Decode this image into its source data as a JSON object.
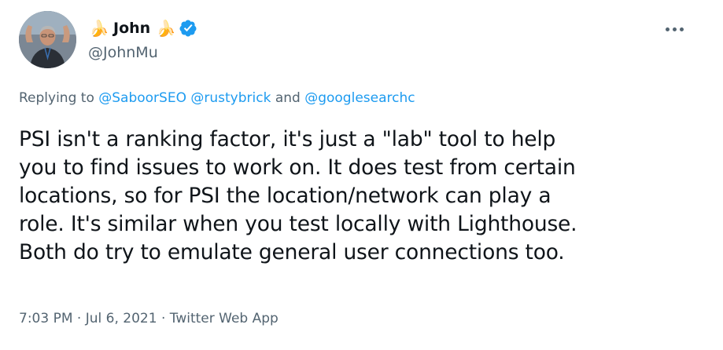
{
  "author": {
    "emoji_left": "🍌",
    "display_name": "John",
    "emoji_right": "🍌",
    "handle": "@JohnMu",
    "verified_icon": "verified-badge-icon",
    "verified_color": "#1d9bf0"
  },
  "reply": {
    "prefix": "Replying to ",
    "mention_1": "@SaboorSEO",
    "mention_2": "@rustybrick",
    "conjunction": "and",
    "mention_3": "@googlesearchc"
  },
  "tweet": {
    "lines": [
      "PSI isn't a ranking factor, it's just a \"lab\" tool to help",
      "you to find issues to work on. It does test from certain",
      "locations, so for PSI the location/network can play a",
      "role. It's similar when you test locally with Lighthouse.",
      "Both do try to emulate general user connections too."
    ]
  },
  "meta": {
    "time": "7:03 PM",
    "separator": "·",
    "date": "Jul 6, 2021",
    "source": "Twitter Web App"
  },
  "icons": {
    "more": "more-options-icon",
    "avatar": "avatar"
  },
  "colors": {
    "link": "#1d9bf0",
    "secondary_text": "#536471",
    "primary_text": "#0f1419"
  }
}
